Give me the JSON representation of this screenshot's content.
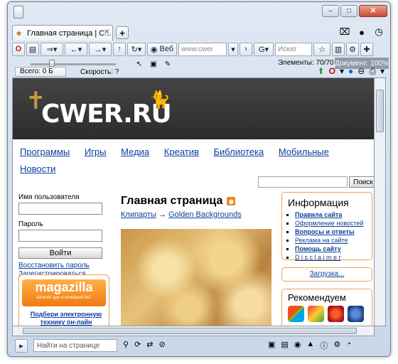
{
  "window": {
    "tab_title": "Главная страница | C...",
    "tab_close": "✕",
    "new_tab": "+",
    "min": "–",
    "max": "□",
    "close": "✕"
  },
  "navbar": {
    "web_label": "Веб",
    "url_text": "www.cwer",
    "search_placeholder": "Искат"
  },
  "toolbar": {
    "elements_label": "Элементы:",
    "elements_value": "70/70",
    "document_label": "Документ: 100%"
  },
  "downloads": {
    "total_label": "Всего:",
    "total_value": "0 Б",
    "speed_label": "Скорость:",
    "speed_value": "?"
  },
  "site": {
    "logo": "CWER.RU",
    "menu": [
      "Программы",
      "Игры",
      "Медиа",
      "Креатив",
      "Библиотека",
      "Мобильные",
      "Новости"
    ],
    "search_button": "Поиск",
    "login": {
      "username_label": "Имя пользователя",
      "password_label": "Пароль",
      "submit": "Войти",
      "restore": "Восстановить пароль",
      "register": "Зарегистрироваться"
    },
    "ad": {
      "brand": "magazilla",
      "tagline": "каталог цен и описаний №1",
      "link": "Подбери электронную технику он-лайн"
    },
    "main": {
      "title": "Главная страница",
      "crumb1": "Клипарты",
      "arrow": "→",
      "crumb2": "Golden Backgrounds"
    },
    "info": {
      "title": "Информация",
      "items": [
        "Правила сайта",
        "Оформление новостей",
        "Вопросы и ответы",
        "Реклама на сайте",
        "Помощь сайту",
        "D i s c l a i m e r"
      ]
    },
    "loading": "Загрузка...",
    "recommend": "Рекомендуем"
  },
  "statusbar": {
    "find_placeholder": "Найти на странице"
  },
  "colors": {
    "link": "#0b3e9c",
    "accent_orange": "#f0a050",
    "header_dark": "#333333"
  }
}
